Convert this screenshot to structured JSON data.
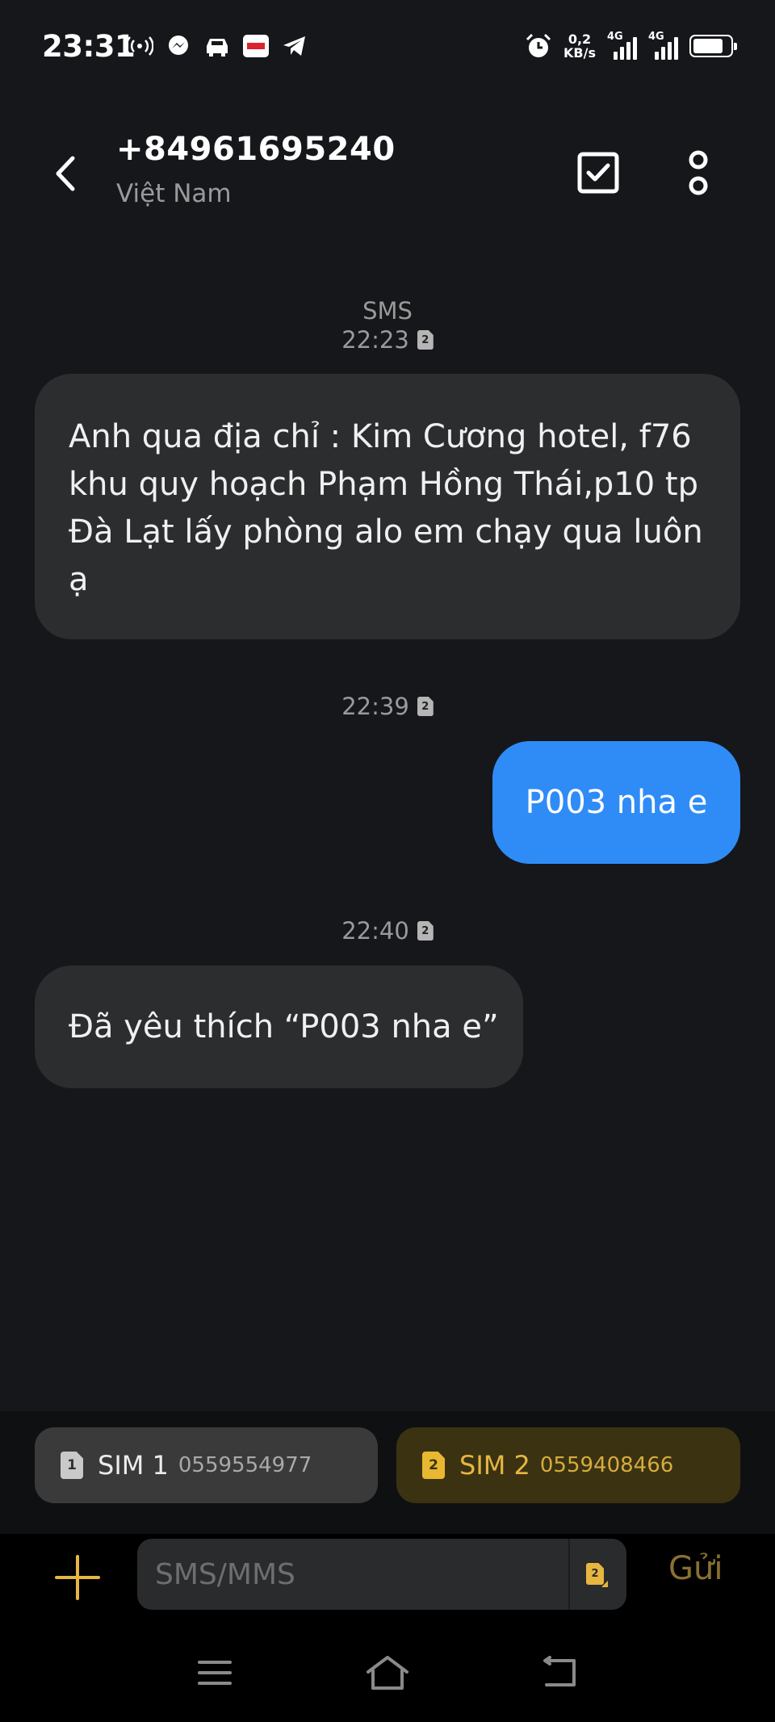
{
  "status_bar": {
    "time": "23:31",
    "speed_value": "0,2",
    "speed_unit": "KB/s",
    "network_1": "4G",
    "network_2": "4G",
    "left_icons": [
      "hotspot-icon",
      "messenger-icon",
      "car-icon",
      "viettel-app-icon",
      "telegram-icon"
    ],
    "right_icons": [
      "alarm-icon",
      "signal-icon",
      "signal-icon",
      "battery-icon"
    ]
  },
  "header": {
    "contact_number": "+84961695240",
    "contact_country": "Việt Nam"
  },
  "conversation": {
    "channel_label": "SMS",
    "messages": [
      {
        "time": "22:23",
        "sim": "2",
        "direction": "incoming",
        "text": "Anh qua địa chỉ : Kim Cương hotel, f76 khu quy hoạch Phạm Hồng Thái,p10 tp Đà Lạt lấy phòng alo em chạy qua luôn ạ"
      },
      {
        "time": "22:39",
        "sim": "2",
        "direction": "outgoing",
        "text": "P003 nha e"
      },
      {
        "time": "22:40",
        "sim": "2",
        "direction": "incoming",
        "text": "Đã yêu thích “P003 nha e”"
      }
    ]
  },
  "sim_selector": {
    "sim1": {
      "badge": "1",
      "label": "SIM 1",
      "number": "0559554977"
    },
    "sim2": {
      "badge": "2",
      "label": "SIM 2",
      "number": "0559408466"
    }
  },
  "compose": {
    "placeholder": "SMS/MMS",
    "active_sim_badge": "2",
    "send_label": "Gửi"
  },
  "colors": {
    "background": "#15171b",
    "incoming_bubble": "#2c2d2f",
    "outgoing_bubble": "#2f8cf7",
    "accent_gold": "#e6b640"
  }
}
